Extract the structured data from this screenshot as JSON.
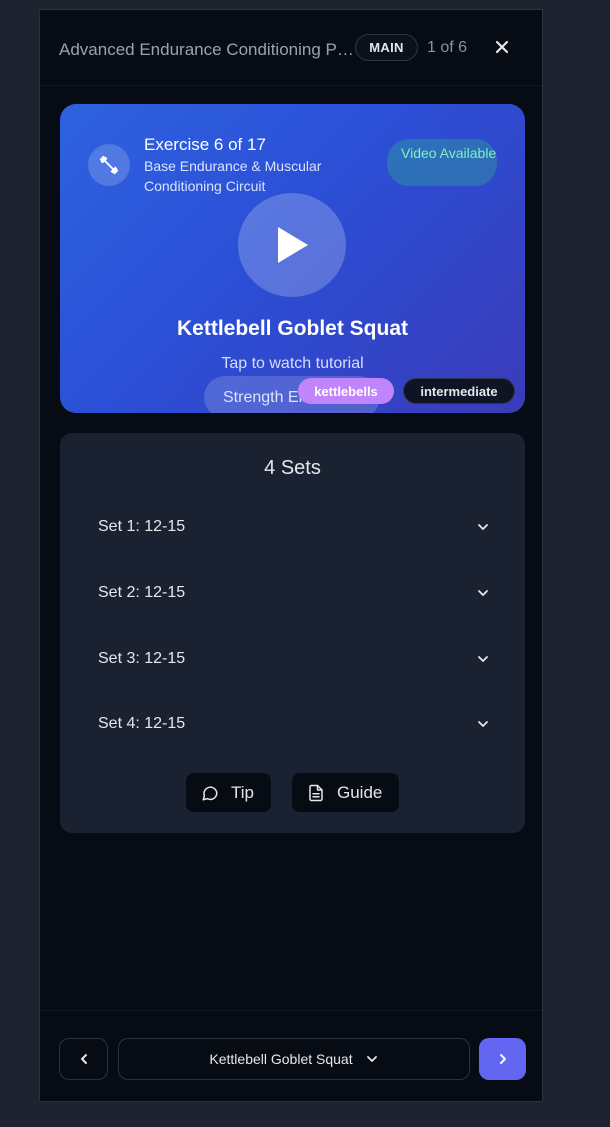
{
  "header": {
    "title": "Advanced Endurance Conditioning Program",
    "badge": "MAIN",
    "counter": "1 of 6"
  },
  "hero": {
    "exercise_count": "Exercise 6 of 17",
    "circuit": "Base Endurance & Muscular Conditioning Circuit",
    "video_badge": "Video Available",
    "exercise_name": "Kettlebell Goblet Squat",
    "tap_hint": "Tap to watch tutorial",
    "category": "Strength Endurance",
    "tags": [
      "kettlebells",
      "intermediate"
    ],
    "colors": {
      "gradient_start": "#2e62e0",
      "gradient_end": "#3a3bb9",
      "tag_kettlebells": "#c084fc"
    }
  },
  "sets": {
    "title": "4 Sets",
    "rows": [
      {
        "label": "Set 1: 12-15"
      },
      {
        "label": "Set 2: 12-15"
      },
      {
        "label": "Set 3: 12-15"
      },
      {
        "label": "Set 4: 12-15"
      }
    ],
    "tip_label": "Tip",
    "guide_label": "Guide"
  },
  "footer": {
    "selected_exercise": "Kettlebell Goblet Squat",
    "accent": "#6366f1"
  },
  "icons": [
    "close-icon",
    "dumbbell-icon",
    "play-icon",
    "chevron-down-icon",
    "message-circle-icon",
    "document-icon",
    "chevron-left-icon",
    "chevron-right-icon"
  ]
}
